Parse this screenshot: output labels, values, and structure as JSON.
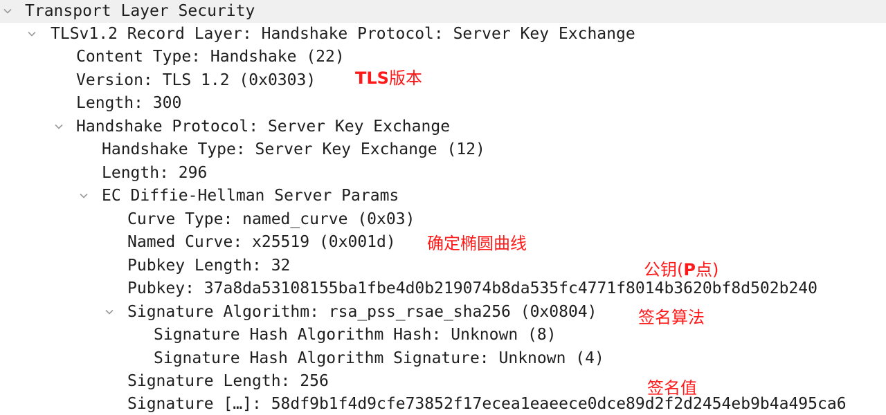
{
  "tree": {
    "rows": [
      {
        "label": "Transport Layer Security",
        "expanded": true
      },
      {
        "label": "TLSv1.2 Record Layer: Handshake Protocol: Server Key Exchange",
        "expanded": true
      },
      {
        "label": "Content Type: Handshake (22)"
      },
      {
        "label": "Version: TLS 1.2 (0x0303)"
      },
      {
        "label": "Length: 300"
      },
      {
        "label": "Handshake Protocol: Server Key Exchange",
        "expanded": true
      },
      {
        "label": "Handshake Type: Server Key Exchange (12)"
      },
      {
        "label": "Length: 296"
      },
      {
        "label": "EC Diffie-Hellman Server Params",
        "expanded": true
      },
      {
        "label": "Curve Type: named_curve (0x03)"
      },
      {
        "label": "Named Curve: x25519 (0x001d)"
      },
      {
        "label": "Pubkey Length: 32"
      },
      {
        "label": "Pubkey: 37a8da53108155ba1fbe4d0b219074b8da535fc4771f8014b3620bf8d502b240"
      },
      {
        "label": "Signature Algorithm: rsa_pss_rsae_sha256 (0x0804)",
        "expanded": true
      },
      {
        "label": "Signature Hash Algorithm Hash: Unknown (8)"
      },
      {
        "label": "Signature Hash Algorithm Signature: Unknown (4)"
      },
      {
        "label": "Signature Length: 256"
      },
      {
        "label": "Signature […]: 58df9b1f4d9cfe73852f17ecea1eaeece0dce89d2f2d2454eb9b4a495ca6"
      }
    ]
  },
  "annotations": {
    "tls_version_latin": "TLS",
    "tls_version_cjk": "版本",
    "curve": "确定椭圆曲线",
    "pubkey_pre": "公钥(",
    "pubkey_bold": "P",
    "pubkey_post": "点)",
    "sig_algo": "签名算法",
    "sig_value": "签名值"
  },
  "colors": {
    "text": "#1e1e1e",
    "annotation": "#ff1a1a",
    "arrow": "#9a9a9a",
    "header_band": "#f0f0f0"
  },
  "icons": {
    "expand": "chevron-down-icon"
  }
}
